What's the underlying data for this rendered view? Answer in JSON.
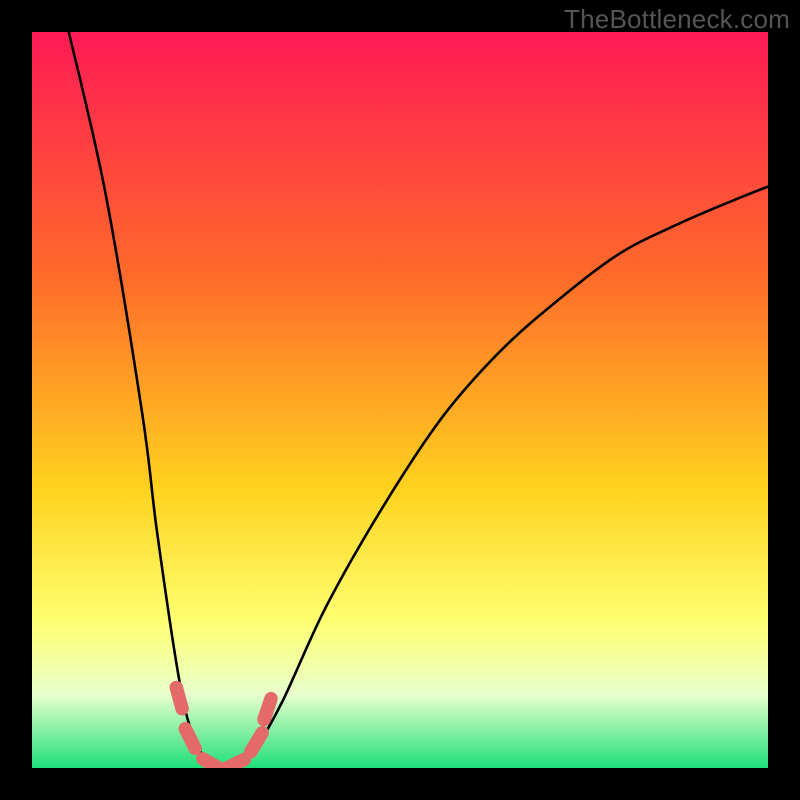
{
  "watermark": "TheBottleneck.com",
  "colors": {
    "bg_black": "#000000",
    "gradient_top": "#ff1a55",
    "gradient_mid1": "#ff6a2a",
    "gradient_mid2": "#ffd21e",
    "gradient_mid3": "#ffff70",
    "gradient_bottom_pale": "#e8ffcc",
    "gradient_bottom_green": "#1fe07c",
    "curve": "#000000",
    "marker": "#e46a6a"
  },
  "chart_data": {
    "type": "line",
    "title": "",
    "xlabel": "",
    "ylabel": "",
    "xlim": [
      0,
      100
    ],
    "ylim": [
      0,
      100
    ],
    "series": [
      {
        "name": "bottleneck-curve",
        "x": [
          5,
          10,
          15,
          17,
          20,
          22,
          24,
          26,
          28,
          30,
          34,
          40,
          48,
          56,
          64,
          72,
          80,
          88,
          95,
          100
        ],
        "y": [
          100,
          78,
          48,
          32,
          12,
          4,
          1,
          0,
          0,
          2,
          9,
          22,
          36,
          48,
          57,
          64,
          70,
          74,
          77,
          79
        ]
      }
    ],
    "markers": {
      "name": "highlighted-segments",
      "points": [
        {
          "x": 20.0,
          "y": 9.5
        },
        {
          "x": 21.5,
          "y": 4.0
        },
        {
          "x": 24.5,
          "y": 0.5
        },
        {
          "x": 27.5,
          "y": 0.5
        },
        {
          "x": 30.5,
          "y": 3.5
        },
        {
          "x": 32.0,
          "y": 8.0
        }
      ]
    },
    "background_gradient": {
      "direction": "vertical",
      "stops": [
        {
          "pos": 0.0,
          "color": "#ff1a55"
        },
        {
          "pos": 0.33,
          "color": "#ff6a2a"
        },
        {
          "pos": 0.62,
          "color": "#ffd21e"
        },
        {
          "pos": 0.8,
          "color": "#ffff70"
        },
        {
          "pos": 0.9,
          "color": "#e8ffcc"
        },
        {
          "pos": 1.0,
          "color": "#1fe07c"
        }
      ]
    }
  }
}
